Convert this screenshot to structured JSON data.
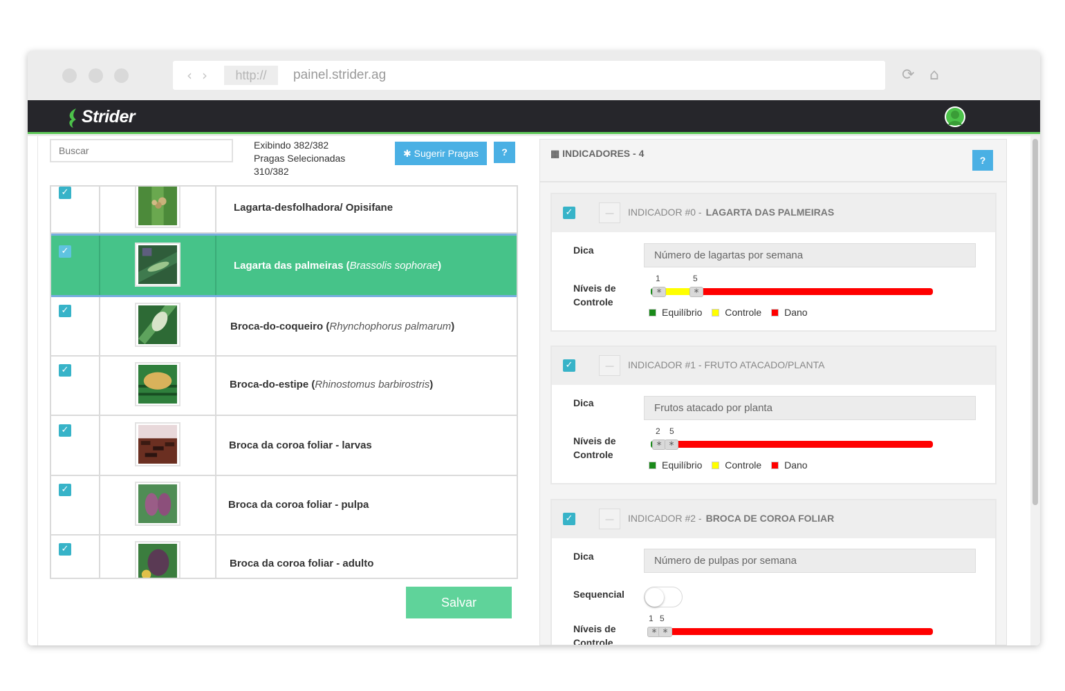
{
  "browser": {
    "protocol": "http://",
    "url": "painel.strider.ag"
  },
  "app": {
    "brand": "Strider"
  },
  "pests_panel": {
    "search_placeholder": "Buscar",
    "showing": "Exibindo 382/382",
    "selected_label": "Pragas Selecionadas",
    "selected_count": "310/382",
    "suggest_button": "Sugerir Pragas",
    "help_button": "?",
    "save_button": "Salvar",
    "rows": [
      {
        "name": "Lagarta-desfolhadora/ Opisifane",
        "scientific": "",
        "checked": true,
        "selected": false
      },
      {
        "name": "Lagarta das palmeiras",
        "scientific": "Brassolis sophorae",
        "checked": true,
        "selected": true
      },
      {
        "name": "Broca-do-coqueiro",
        "scientific": "Rhynchophorus palmarum",
        "checked": true,
        "selected": false
      },
      {
        "name": "Broca-do-estipe",
        "scientific": "Rhinostomus barbirostris",
        "checked": true,
        "selected": false
      },
      {
        "name": "Broca da coroa foliar - larvas",
        "scientific": "",
        "checked": true,
        "selected": false
      },
      {
        "name": "Broca da coroa foliar - pulpa",
        "scientific": "",
        "checked": true,
        "selected": false
      },
      {
        "name": "Broca da coroa foliar - adulto",
        "scientific": "",
        "checked": true,
        "selected": false
      }
    ]
  },
  "indicators_panel": {
    "title": "INDICADORES - 4",
    "help_button": "?",
    "dica_label": "Dica",
    "niveis_label_1": "Níveis de",
    "niveis_label_2": "Controle",
    "sequencial_label": "Sequencial",
    "legend": {
      "equilibrio": "Equilíbrio",
      "controle": "Controle",
      "dano": "Dano"
    },
    "colors": {
      "equilibrio": "#1a8a1a",
      "controle": "#ffff00",
      "dano": "#ff0000"
    },
    "cards": [
      {
        "prefix": "INDICADOR #0 -",
        "name": "LAGARTA DAS PALMEIRAS",
        "dica": "Número de lagartas por semana",
        "low": "1",
        "high": "5"
      },
      {
        "prefix": "INDICADOR #1 - FRUTO ATACADO/PLANTA",
        "name": "",
        "dica": "Frutos atacado por planta",
        "low": "2",
        "high": "5"
      },
      {
        "prefix": "INDICADOR #2 -",
        "name": "BROCA DE COROA FOLIAR",
        "dica": "Número de pulpas por semana",
        "low": "1",
        "high": "5"
      }
    ]
  }
}
